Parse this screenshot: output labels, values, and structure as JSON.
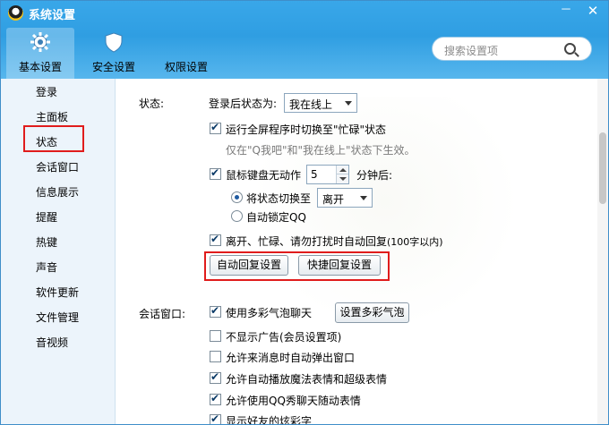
{
  "window": {
    "title": "系统设置",
    "minimize": "－",
    "close": "✕"
  },
  "top_tabs": [
    {
      "label": "基本设置",
      "icon": "gear-icon"
    },
    {
      "label": "安全设置",
      "icon": "shield-icon"
    },
    {
      "label": "权限设置",
      "icon": ""
    }
  ],
  "search": {
    "placeholder": "搜索设置项",
    "icon": "search-icon"
  },
  "sidebar": {
    "items": [
      "登录",
      "主面板",
      "状态",
      "会话窗口",
      "信息展示",
      "提醒",
      "热键",
      "声音",
      "软件更新",
      "文件管理",
      "音视频"
    ],
    "selected": "状态"
  },
  "status_section": {
    "heading": "状态:",
    "after_login_label": "登录后状态为:",
    "after_login_value": "我在线上",
    "fullscreen_busy": {
      "label": "运行全屏程序时切换至\"忙碌\"状态",
      "checked": true
    },
    "fullscreen_hint": "仅在\"Q我吧\"和\"我在线上\"状态下生效。",
    "idle": {
      "label": "鼠标键盘无动作",
      "checked": true,
      "minutes": "5",
      "suffix": "分钟后:"
    },
    "switch_radio": {
      "label": "将状态切换至",
      "selected": true,
      "value": "离开"
    },
    "lock_radio": {
      "label": "自动锁定QQ",
      "selected": false
    },
    "auto_reply": {
      "label": "离开、忙碌、请勿打扰时自动回复",
      "note": "(100字以内)",
      "checked": true
    },
    "auto_reply_button": "自动回复设置",
    "quick_reply_button": "快捷回复设置"
  },
  "chat_section": {
    "heading": "会话窗口:",
    "bubble": {
      "label": "使用多彩气泡聊天",
      "checked": true
    },
    "bubble_button": "设置多彩气泡",
    "no_ads": {
      "label": "不显示广告(会员设置项)",
      "checked": false
    },
    "popup": {
      "label": "允许来消息时自动弹出窗口",
      "checked": false
    },
    "magic": {
      "label": "允许自动播放魔法表情和超级表情",
      "checked": true
    },
    "qqshow": {
      "label": "允许使用QQ秀聊天随动表情",
      "checked": true
    },
    "colorful": {
      "label": "显示好友的炫彩字",
      "checked": true
    }
  },
  "colors": {
    "title_bar": "#39a7e9",
    "sidebar_bg": "#ecf4fb",
    "highlight_red": "#e01c1c"
  }
}
